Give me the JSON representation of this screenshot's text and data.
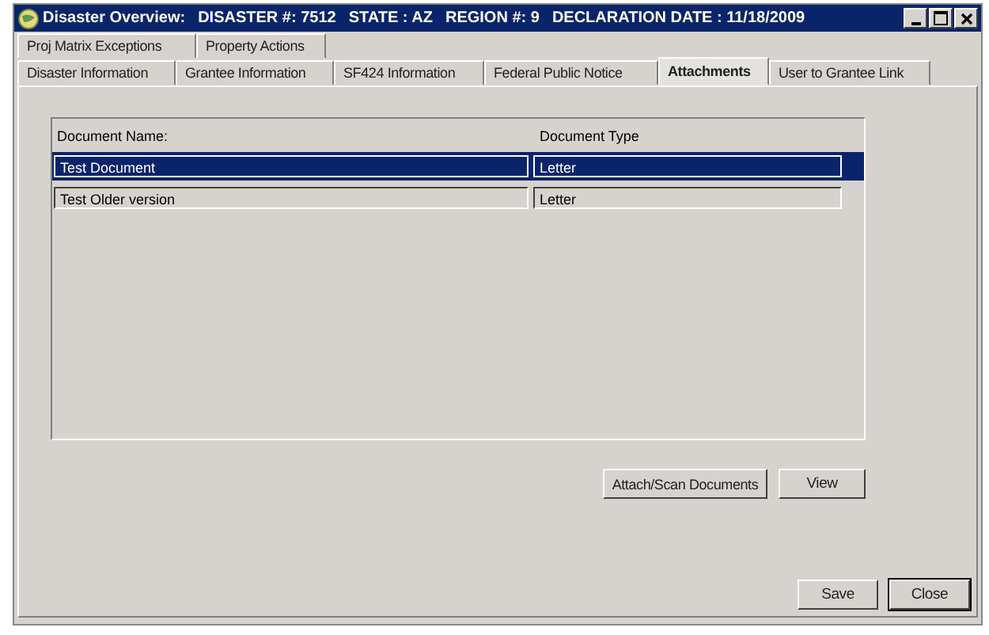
{
  "window": {
    "title": "Disaster Overview:",
    "details": [
      "DISASTER #: 7512",
      "STATE : AZ",
      "REGION #: 9",
      "DECLARATION DATE : 11/18/2009"
    ]
  },
  "tab_rows": [
    [
      {
        "label": "Proj Matrix Exceptions",
        "selected": false
      },
      {
        "label": "Property Actions",
        "selected": false
      }
    ],
    [
      {
        "label": "Disaster Information",
        "selected": false
      },
      {
        "label": "Grantee Information",
        "selected": false
      },
      {
        "label": "SF424  Information",
        "selected": false
      },
      {
        "label": "Federal Public Notice",
        "selected": false
      },
      {
        "label": "Attachments",
        "selected": true
      },
      {
        "label": "User to Grantee Link",
        "selected": false
      }
    ]
  ],
  "table": {
    "columns": [
      "Document Name:",
      "Document Type"
    ],
    "rows": [
      {
        "cells": [
          "Test Document",
          "Letter"
        ],
        "selected": true
      },
      {
        "cells": [
          "Test Older version",
          "Letter"
        ],
        "selected": false
      }
    ]
  },
  "list_buttons": [
    "Attach/Scan Documents",
    "View"
  ],
  "footer_buttons": [
    "Save",
    "Close"
  ]
}
